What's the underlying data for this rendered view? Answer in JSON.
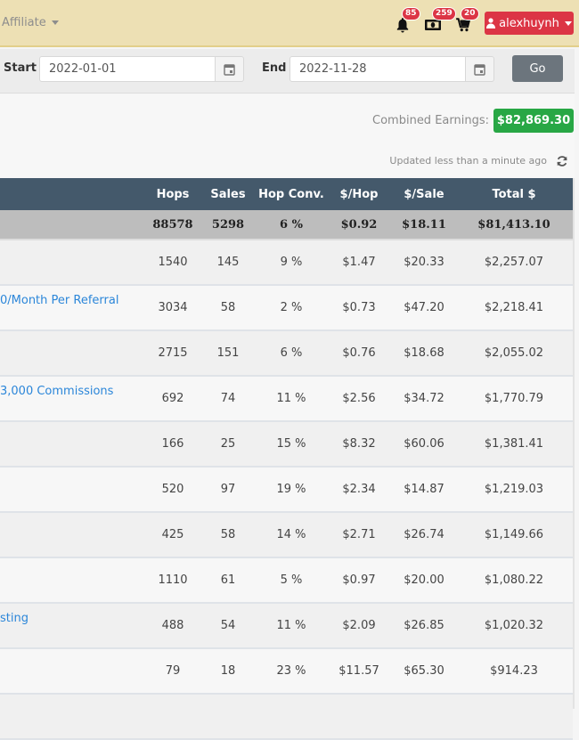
{
  "topbar": {
    "nav_affiliate": "Affiliate",
    "notifications": {
      "icon": "bell-icon",
      "count": "85"
    },
    "payments": {
      "icon": "money-icon",
      "count": "259"
    },
    "cart": {
      "icon": "cart-icon",
      "count": "20"
    },
    "user": {
      "icon": "user-icon",
      "name": "alexhuynh"
    }
  },
  "filters": {
    "start_label": "Start",
    "start_value": "2022-01-01",
    "end_label": "End",
    "end_value": "2022-11-28",
    "go_label": "Go"
  },
  "summary": {
    "combined_label": "Combined Earnings:",
    "combined_value": "$82,869.30",
    "updated_text": "Updated less than a minute ago"
  },
  "colors": {
    "topbar": "#ede0b4",
    "header": "#44596b",
    "danger": "#dc3545",
    "success": "#28a745",
    "link": "#2b86d9"
  },
  "table": {
    "columns": [
      "",
      "Hops",
      "Sales",
      "Hop Conv.",
      "$/Hop",
      "$/Sale",
      "Total $"
    ],
    "total": {
      "hops": "88578",
      "sales": "5298",
      "conv": "6 %",
      "per_hop": "$0.92",
      "per_sale": "$18.11",
      "total": "$81,413.10"
    },
    "rows": [
      {
        "name": "",
        "hops": "1540",
        "sales": "145",
        "conv": "9 %",
        "per_hop": "$1.47",
        "per_sale": "$20.33",
        "total": "$2,257.07"
      },
      {
        "name": "0/Month Per Referral",
        "hops": "3034",
        "sales": "58",
        "conv": "2 %",
        "per_hop": "$0.73",
        "per_sale": "$47.20",
        "total": "$2,218.41"
      },
      {
        "name": "",
        "hops": "2715",
        "sales": "151",
        "conv": "6 %",
        "per_hop": "$0.76",
        "per_sale": "$18.68",
        "total": "$2,055.02"
      },
      {
        "name": "3,000 Commissions",
        "hops": "692",
        "sales": "74",
        "conv": "11 %",
        "per_hop": "$2.56",
        "per_sale": "$34.72",
        "total": "$1,770.79"
      },
      {
        "name": "",
        "hops": "166",
        "sales": "25",
        "conv": "15 %",
        "per_hop": "$8.32",
        "per_sale": "$60.06",
        "total": "$1,381.41"
      },
      {
        "name": "",
        "hops": "520",
        "sales": "97",
        "conv": "19 %",
        "per_hop": "$2.34",
        "per_sale": "$14.87",
        "total": "$1,219.03"
      },
      {
        "name": "",
        "hops": "425",
        "sales": "58",
        "conv": "14 %",
        "per_hop": "$2.71",
        "per_sale": "$26.74",
        "total": "$1,149.66"
      },
      {
        "name": "",
        "hops": "1110",
        "sales": "61",
        "conv": "5 %",
        "per_hop": "$0.97",
        "per_sale": "$20.00",
        "total": "$1,080.22"
      },
      {
        "name": "sting",
        "hops": "488",
        "sales": "54",
        "conv": "11 %",
        "per_hop": "$2.09",
        "per_sale": "$26.85",
        "total": "$1,020.32"
      },
      {
        "name": "",
        "hops": "79",
        "sales": "18",
        "conv": "23 %",
        "per_hop": "$11.57",
        "per_sale": "$65.30",
        "total": "$914.23"
      },
      {
        "name": "",
        "hops": "",
        "sales": "",
        "conv": "",
        "per_hop": "",
        "per_sale": "",
        "total": ""
      }
    ]
  }
}
